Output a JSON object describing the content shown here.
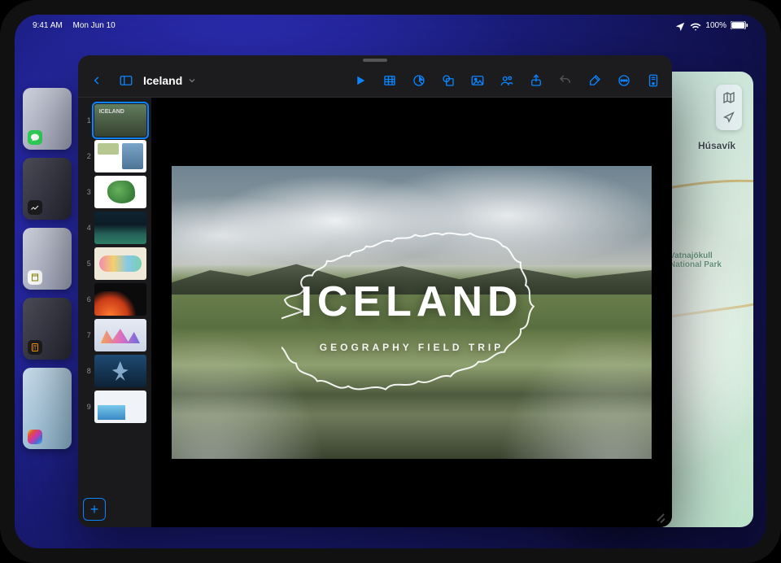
{
  "statusbar": {
    "time": "9:41 AM",
    "date": "Mon Jun 10",
    "battery_pct": "100%"
  },
  "background_app": {
    "name": "Maps",
    "city_label": "Húsavík",
    "park_label": "Vatnajökull National Park",
    "controls": {
      "map_mode_icon": "map-mode-icon",
      "locate_icon": "location-arrow-icon"
    }
  },
  "side_apps": [
    {
      "name": "Messages",
      "icon": "message-icon"
    },
    {
      "name": "Stocks",
      "icon": "stocks-icon"
    },
    {
      "name": "Notes",
      "icon": "notes-icon"
    },
    {
      "name": "Calculator",
      "icon": "calculator-icon"
    },
    {
      "name": "Photos",
      "icon": "photos-icon"
    }
  ],
  "keynote": {
    "doc_title": "Iceland",
    "toolbar": {
      "back": "back-button",
      "sidebar": "sidebar-toggle",
      "play": "play-button",
      "table": "insert-table-button",
      "chart": "insert-chart-button",
      "shape": "insert-shape-button",
      "image": "insert-media-button",
      "collab": "collaborate-button",
      "share": "share-button",
      "undo": "undo-button",
      "format": "format-brush-button",
      "more": "more-options-button",
      "document": "document-settings-button"
    },
    "add_slide_label": "+",
    "slides": [
      {
        "n": "1",
        "thumb_label": "ICELAND",
        "selected": true
      },
      {
        "n": "2",
        "selected": false
      },
      {
        "n": "3",
        "selected": false
      },
      {
        "n": "4",
        "selected": false
      },
      {
        "n": "5",
        "selected": false
      },
      {
        "n": "6",
        "selected": false
      },
      {
        "n": "7",
        "selected": false
      },
      {
        "n": "8",
        "selected": false
      },
      {
        "n": "9",
        "selected": false
      }
    ],
    "canvas": {
      "title": "ICELAND",
      "subtitle": "GEOGRAPHY FIELD TRIP"
    }
  }
}
